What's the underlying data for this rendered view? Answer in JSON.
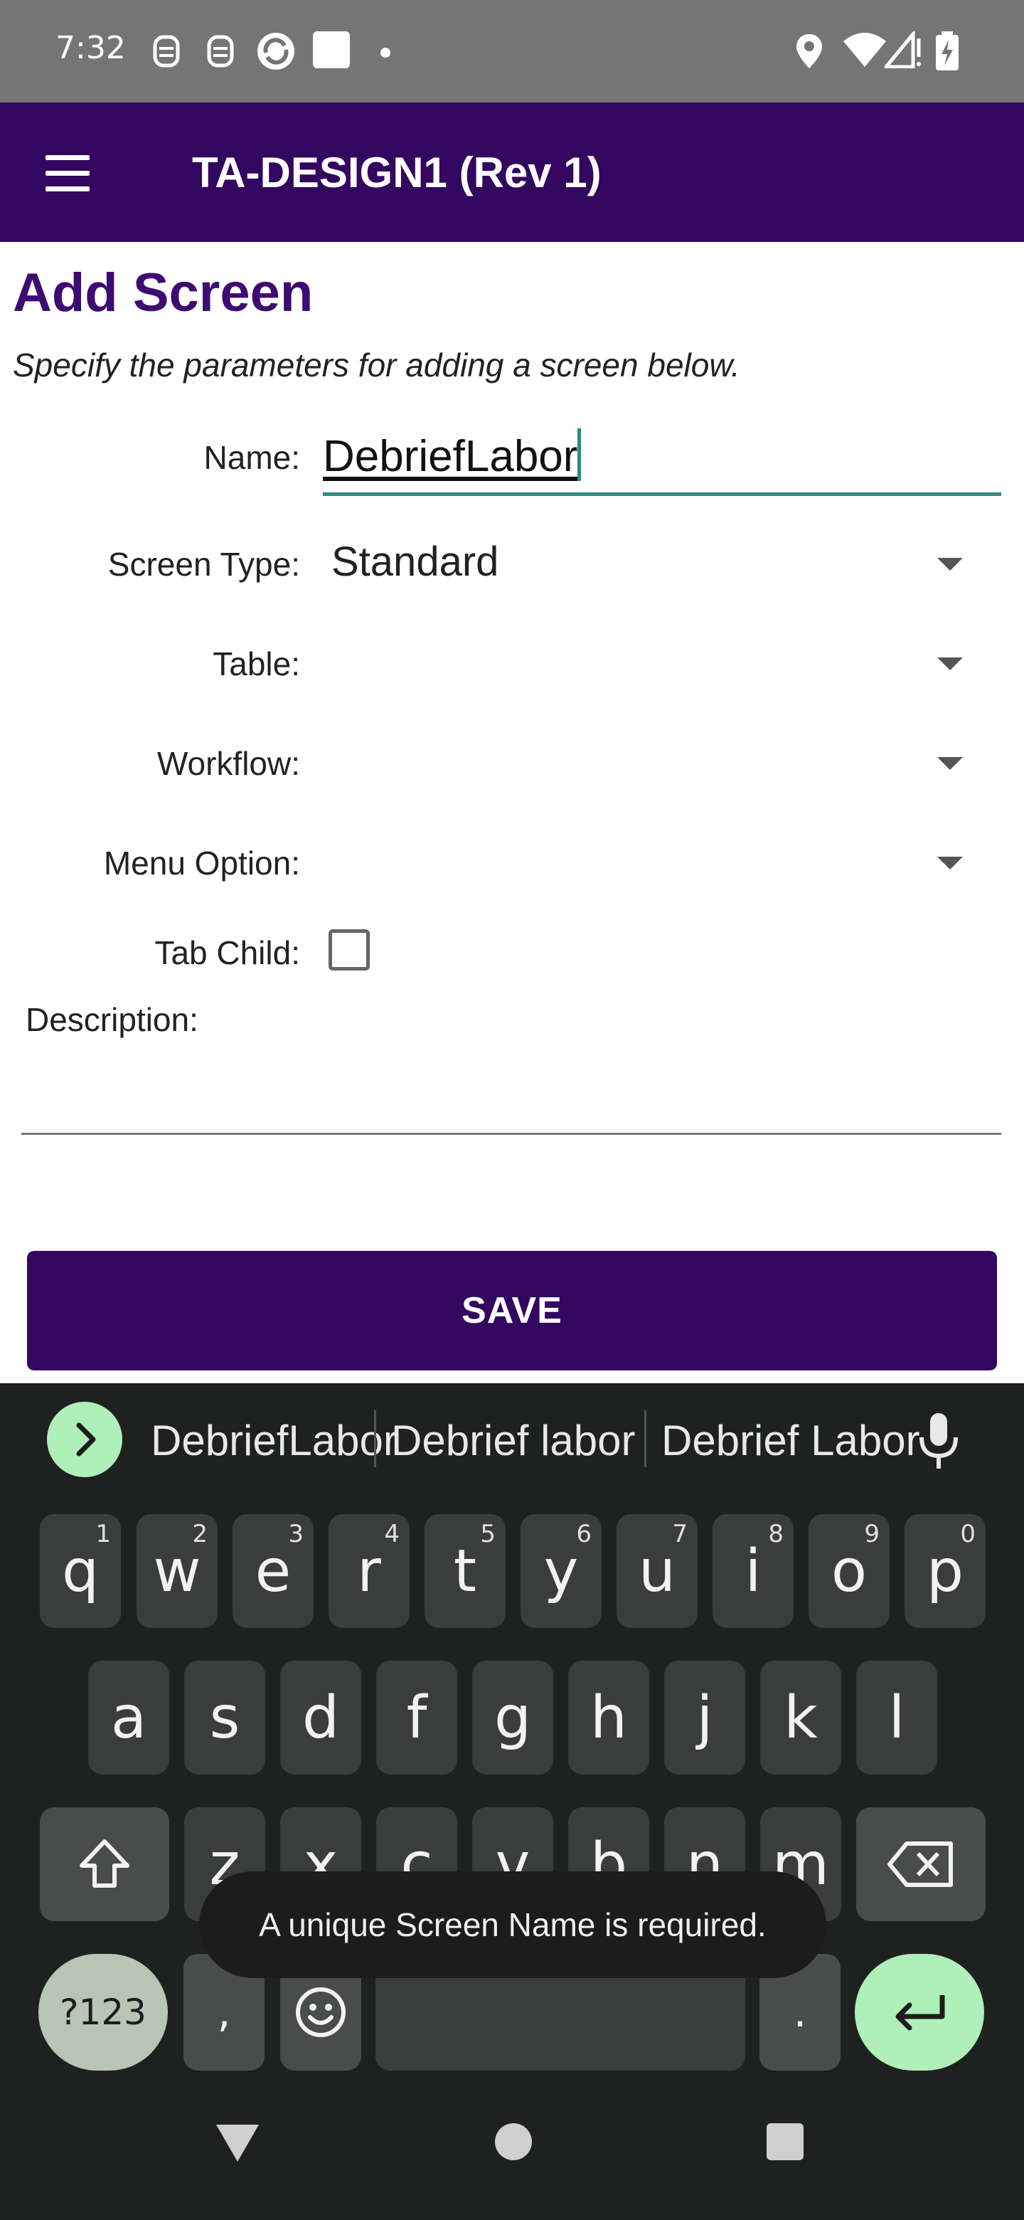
{
  "status_bar": {
    "time": "7:32",
    "icons": [
      "notification-app-icon",
      "notification-app-icon",
      "sync-icon",
      "square-icon",
      "dot-icon",
      "location-icon",
      "wifi-icon",
      "signal-icon",
      "battery-charging-icon"
    ]
  },
  "app_bar": {
    "menu_icon": "hamburger-menu-icon",
    "title": "TA-DESIGN1 (Rev 1)",
    "color": "#33065f"
  },
  "form": {
    "title": "Add Screen",
    "subtitle": "Specify the parameters for adding a screen below.",
    "name_label": "Name:",
    "name_value": "DebriefLabor",
    "screen_type_label": "Screen Type:",
    "screen_type_value": "Standard",
    "table_label": "Table:",
    "table_value": "",
    "workflow_label": "Workflow:",
    "workflow_value": "",
    "menu_option_label": "Menu Option:",
    "menu_option_value": "",
    "tab_child_label": "Tab Child:",
    "tab_child_checked": false,
    "description_label": "Description:",
    "description_value": "",
    "save_label": "SAVE"
  },
  "keyboard": {
    "suggestions": [
      "DebriefLabor",
      "Debrief labor",
      "Debrief Labor"
    ],
    "row1": [
      {
        "key": "q",
        "sup": "1"
      },
      {
        "key": "w",
        "sup": "2"
      },
      {
        "key": "e",
        "sup": "3"
      },
      {
        "key": "r",
        "sup": "4"
      },
      {
        "key": "t",
        "sup": "5"
      },
      {
        "key": "y",
        "sup": "6"
      },
      {
        "key": "u",
        "sup": "7"
      },
      {
        "key": "i",
        "sup": "8"
      },
      {
        "key": "o",
        "sup": "9"
      },
      {
        "key": "p",
        "sup": "0"
      }
    ],
    "row2": [
      "a",
      "s",
      "d",
      "f",
      "g",
      "h",
      "j",
      "k",
      "l"
    ],
    "row3": [
      "z",
      "x",
      "c",
      "v",
      "b",
      "n",
      "m"
    ],
    "symbols_label": "?123",
    "comma_label": ",",
    "period_label": ".",
    "accent_color": "#aef0b8"
  },
  "toast": {
    "message": "A unique Screen Name is required."
  },
  "nav_bar": {
    "icons": [
      "back-icon",
      "home-icon",
      "recents-icon"
    ]
  }
}
